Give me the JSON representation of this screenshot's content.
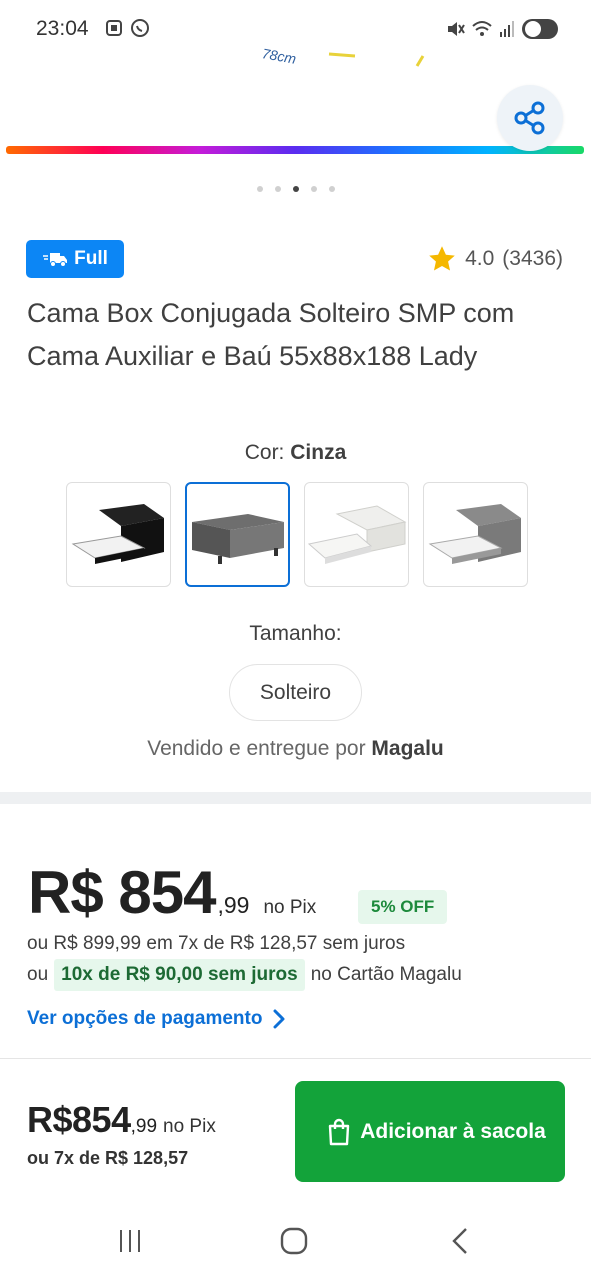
{
  "status_bar": {
    "time": "23:04"
  },
  "gallery": {
    "hint_text": "78cm",
    "dots_count": 5,
    "active_dot": 2
  },
  "product": {
    "badge": "Full",
    "rating": "4.0",
    "reviews": "(3436)",
    "title": "Cama Box Conjugada Solteiro SMP com Cama Auxiliar e Baú 55x88x188 Lady"
  },
  "color": {
    "label": "Cor:",
    "value": "Cinza",
    "selected_index": 1
  },
  "size": {
    "label": "Tamanho:",
    "option": "Solteiro"
  },
  "seller": {
    "prefix": "Vendido e entregue por",
    "name": "Magalu"
  },
  "price": {
    "main": "R$ 854",
    "cents": ",99",
    "pix_label": "no Pix",
    "off_badge": "5% OFF",
    "installments": "ou R$ 899,99 em 7x de R$ 128,57 sem juros",
    "card_prefix": "ou",
    "card_highlight": "10x de R$ 90,00 sem juros",
    "card_suffix": "no Cartão Magalu",
    "payment_link": "Ver opções de pagamento"
  },
  "bottom_bar": {
    "price": "R$854",
    "cents": ",99",
    "pix_label": "no Pix",
    "installments": "ou 7x de R$ 128,57",
    "add_button": "Adicionar à sacola"
  },
  "colors": {
    "primary_blue": "#0c86f5",
    "link_blue": "#0c6fd6",
    "green": "#13a33a",
    "star": "#f5b800"
  }
}
